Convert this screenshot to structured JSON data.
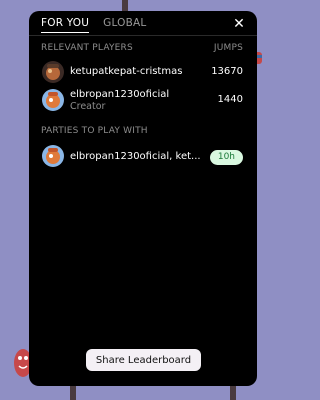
{
  "tabs": [
    {
      "label": "FOR YOU",
      "active": true
    },
    {
      "label": "GLOBAL",
      "active": false
    }
  ],
  "relevant": {
    "heading": "RELEVANT PLAYERS",
    "column": "JUMPS",
    "players": [
      {
        "name": "ketupatkepat-cristmas",
        "subtitle": "",
        "score": "13670"
      },
      {
        "name": "elbropan1230oficial",
        "subtitle": "Creator",
        "score": "1440"
      }
    ]
  },
  "parties": {
    "heading": "PARTIES TO PLAY WITH",
    "items": [
      {
        "name": "elbropan1230oficial, ket...",
        "time": "10h"
      }
    ]
  },
  "actions": {
    "share_label": "Share Leaderboard"
  },
  "colors": {
    "badge_bg": "#d9f8e0",
    "badge_text": "#1c7a3a",
    "background": "#8f8fc4"
  }
}
